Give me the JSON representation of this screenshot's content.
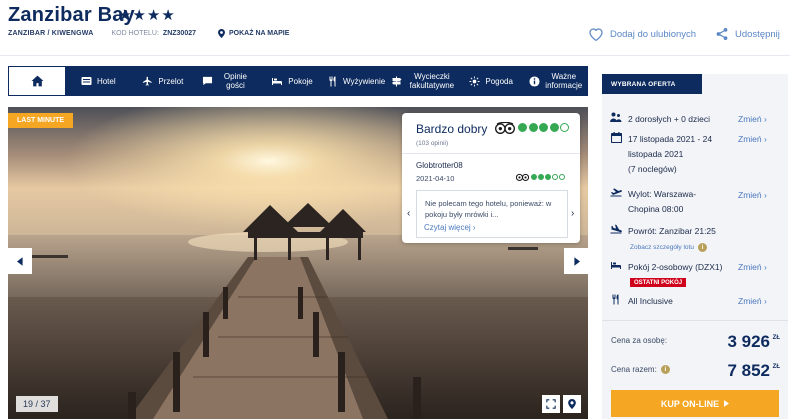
{
  "hotel": {
    "name": "Zanzibar Bay",
    "stars": "★★★★",
    "location": "ZANZIBAR / KIWENGWA",
    "code_label": "KOD HOTELU:",
    "code_value": "ZNZ30027",
    "map_link": "POKAŻ NA MAPIE"
  },
  "actions": {
    "favorite": "Dodaj do ulubionych",
    "share": "Udostępnij"
  },
  "nav": {
    "items": [
      {
        "label": "Hotel",
        "icon": "hotel-icon"
      },
      {
        "label": "Przelot",
        "icon": "plane-icon"
      },
      {
        "label": "Opinie gości",
        "icon": "chat-icon"
      },
      {
        "label": "Pokoje",
        "icon": "bed-icon"
      },
      {
        "label": "Wyżywienie",
        "icon": "cutlery-icon"
      },
      {
        "label": "Wycieczki fakultatywne",
        "icon": "signpost-icon"
      },
      {
        "label": "Pogoda",
        "icon": "sun-icon"
      },
      {
        "label": "Ważne informacje",
        "icon": "info-icon"
      }
    ]
  },
  "gallery": {
    "badge": "LAST MINUTE",
    "counter": "19 / 37"
  },
  "review": {
    "rating_text": "Bardzo dobry",
    "count": "(103 opinii)",
    "rating_level": 4,
    "author": "Globtrotter08",
    "date": "2021-04-10",
    "author_level": 3,
    "quote": "Nie polecam tego hotelu, ponieważ: w pokoju były mrówki i...",
    "read_more": "Czytaj więcej"
  },
  "offer": {
    "header": "WYBRANA OFERTA",
    "change_label": "Zmień",
    "guests": "2 dorosłych + 0 dzieci",
    "dates": [
      "17 listopada 2021 - 24",
      "listopada 2021",
      "(7 noclegów)"
    ],
    "departure": [
      "Wylot: Warszawa-",
      "Chopina 08:00"
    ],
    "return": "Powrót: Zanzibar 21:25",
    "flight_details": "Zobacz szczegóły lotu",
    "room": "Pokój 2-osobowy (DZX1)",
    "room_badge": "OSTATNI POKÓJ",
    "board": "All Inclusive",
    "price_per_person_label": "Cena za osobę:",
    "price_per_person": "3 926",
    "price_total_label": "Cena razem:",
    "price_total": "7 852",
    "currency": "ZŁ",
    "buy_button": "KUP ON-LINE",
    "info_glyph": "i"
  },
  "colors": {
    "navy": "#0d2b5e",
    "orange": "#f5a623",
    "link": "#4a78be",
    "red": "#d0021b",
    "tripadvisor_green": "#34a853"
  }
}
